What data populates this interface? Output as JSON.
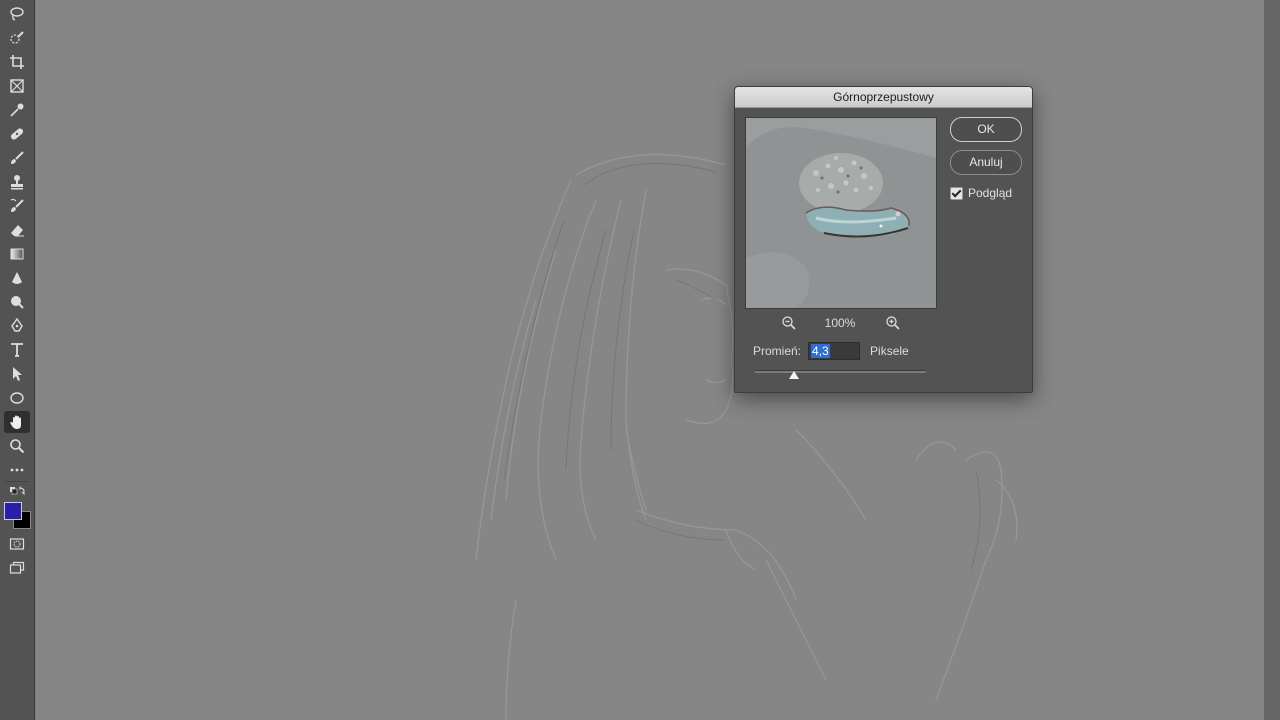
{
  "dialog": {
    "title": "Górnoprzepustowy",
    "ok_label": "OK",
    "cancel_label": "Anuluj",
    "preview_label": "Podgląd",
    "preview_checked": true,
    "zoom": "100%",
    "radius_label": "Promień:",
    "radius_value": "4,3",
    "radius_unit": "Piksele"
  },
  "toolbar": {
    "tools": [
      "lasso-icon",
      "quick-selection-icon",
      "crop-icon",
      "frame-icon",
      "eyedropper-icon",
      "healing-brush-icon",
      "brush-icon",
      "clone-stamp-icon",
      "history-brush-icon",
      "eraser-icon",
      "gradient-icon",
      "blur-icon",
      "dodge-icon",
      "pen-icon",
      "type-icon",
      "path-selection-icon",
      "ellipse-icon",
      "hand-icon",
      "zoom-icon",
      "more-tools-icon",
      "swap-colors-icon",
      "quick-mask-icon",
      "screen-mode-icon"
    ],
    "active_tool": "hand-icon",
    "foreground_color": "#2a1fa8",
    "background_color": "#000000"
  }
}
